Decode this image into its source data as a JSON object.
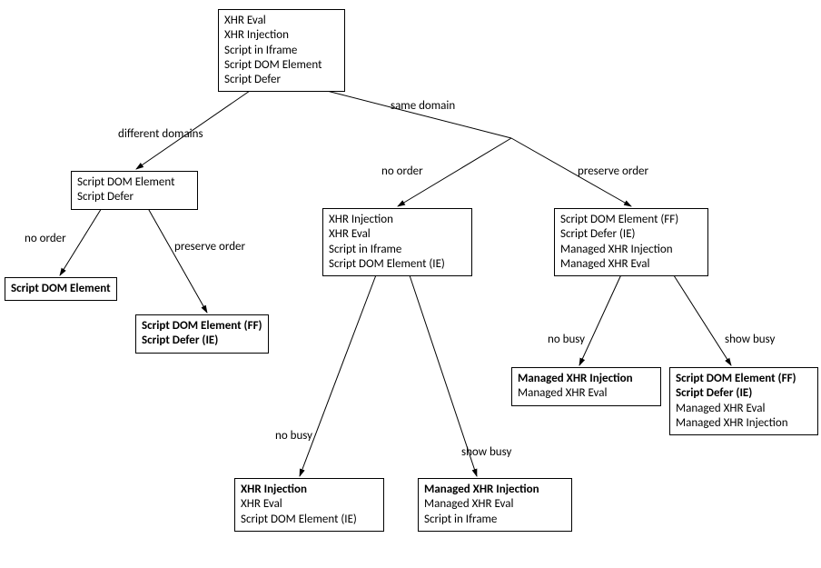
{
  "nodes": {
    "root": {
      "lines": [
        "XHR Eval",
        "XHR Injection",
        "Script in Iframe",
        "Script DOM Element",
        "Script Defer"
      ]
    },
    "diff_domains": {
      "lines": [
        "Script DOM Element",
        "Script Defer"
      ]
    },
    "dd_no_order": {
      "lines": [
        "Script DOM Element"
      ],
      "bold": [
        0
      ]
    },
    "dd_preserve": {
      "lines": [
        "Script DOM Element (FF)",
        "Script Defer (IE)"
      ],
      "bold": [
        0,
        1
      ]
    },
    "sd_no_order": {
      "lines": [
        "XHR Injection",
        "XHR Eval",
        "Script in Iframe",
        "Script DOM Element (IE)"
      ]
    },
    "sd_preserve": {
      "lines": [
        "Script DOM Element (FF)",
        "Script Defer (IE)",
        "Managed XHR Injection",
        "Managed XHR Eval"
      ]
    },
    "sdno_no_busy": {
      "lines": [
        "XHR Injection",
        "XHR Eval",
        "Script DOM Element (IE)"
      ],
      "bold": [
        0
      ]
    },
    "sdno_show_busy": {
      "lines": [
        "Managed XHR Injection",
        "Managed XHR Eval",
        "Script in Iframe"
      ],
      "bold": [
        0
      ]
    },
    "sdpr_no_busy": {
      "lines": [
        "Managed XHR Injection",
        "Managed XHR Eval"
      ],
      "bold": [
        0
      ]
    },
    "sdpr_show_busy": {
      "lines": [
        "Script DOM Element (FF)",
        "Script Defer (IE)",
        "Managed XHR Eval",
        "Managed XHR Injection"
      ],
      "bold": [
        0,
        1
      ]
    }
  },
  "edge_labels": {
    "different_domains": "different domains",
    "same_domain": "same domain",
    "no_order_1": "no order",
    "preserve_order_1": "preserve order",
    "no_order_2": "no order",
    "preserve_order_2": "preserve order",
    "no_busy_1": "no busy",
    "show_busy_1": "show busy",
    "no_busy_2": "no busy",
    "show_busy_2": "show busy"
  }
}
